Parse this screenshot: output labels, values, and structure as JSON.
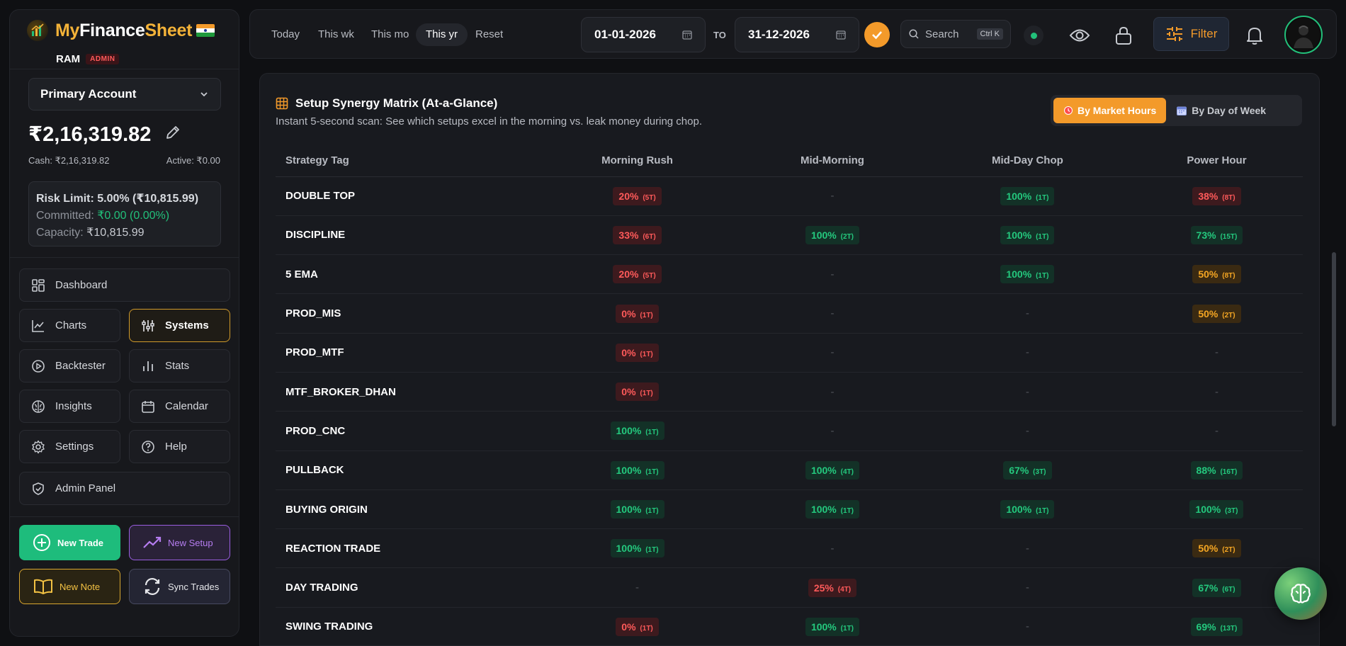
{
  "brand": {
    "name_part1": "My",
    "name_part2": "Finance",
    "name_part3": "Sheet"
  },
  "user": {
    "name": "RAM",
    "role_badge": "ADMIN"
  },
  "account": {
    "selected": "Primary Account",
    "balance": "₹2,16,319.82",
    "cash": "Cash: ₹2,16,319.82",
    "active": "Active: ₹0.00",
    "risk_limit": "Risk Limit: 5.00% (₹10,815.99)",
    "committed_label": "Committed: ",
    "committed_value": "₹0.00 (0.00%)",
    "capacity_label": "Capacity: ",
    "capacity_value": "₹10,815.99"
  },
  "nav": {
    "dashboard": "Dashboard",
    "charts": "Charts",
    "systems": "Systems",
    "backtester": "Backtester",
    "stats": "Stats",
    "insights": "Insights",
    "calendar": "Calendar",
    "settings": "Settings",
    "help": "Help",
    "admin_panel": "Admin Panel"
  },
  "actions": {
    "new_trade": "New Trade",
    "new_setup": "New Setup",
    "new_note": "New Note",
    "sync_trades": "Sync Trades"
  },
  "topbar": {
    "quick_filters": [
      "Today",
      "This wk",
      "This mo",
      "This yr",
      "Reset"
    ],
    "selected_filter": "This yr",
    "date_from": "01-01-2026",
    "to_label": "TO",
    "date_to": "31-12-2026",
    "search_placeholder": "Search",
    "search_shortcut": "Ctrl K",
    "filter_label": "Filter"
  },
  "matrix": {
    "title": "Setup Synergy Matrix (At-a-Glance)",
    "subtitle": "Instant 5-second scan: See which setups excel in the morning vs. leak money during chop.",
    "toggle_market_hours": "By Market Hours",
    "toggle_day_of_week": "By Day of Week",
    "columns": [
      "Strategy Tag",
      "Morning Rush",
      "Mid-Morning",
      "Mid-Day Chop",
      "Power Hour"
    ],
    "rows": [
      {
        "tag": "DOUBLE TOP",
        "cells": [
          {
            "pct": "20%",
            "trades": "(5T)",
            "tone": "red"
          },
          {
            "pct": "-",
            "trades": "",
            "tone": "none"
          },
          {
            "pct": "100%",
            "trades": "(1T)",
            "tone": "green"
          },
          {
            "pct": "38%",
            "trades": "(8T)",
            "tone": "red"
          }
        ]
      },
      {
        "tag": "DISCIPLINE",
        "cells": [
          {
            "pct": "33%",
            "trades": "(6T)",
            "tone": "red"
          },
          {
            "pct": "100%",
            "trades": "(2T)",
            "tone": "green"
          },
          {
            "pct": "100%",
            "trades": "(1T)",
            "tone": "green"
          },
          {
            "pct": "73%",
            "trades": "(15T)",
            "tone": "green"
          }
        ]
      },
      {
        "tag": "5 EMA",
        "cells": [
          {
            "pct": "20%",
            "trades": "(5T)",
            "tone": "red"
          },
          {
            "pct": "-",
            "trades": "",
            "tone": "none"
          },
          {
            "pct": "100%",
            "trades": "(1T)",
            "tone": "green"
          },
          {
            "pct": "50%",
            "trades": "(8T)",
            "tone": "orange"
          }
        ]
      },
      {
        "tag": "PROD_MIS",
        "cells": [
          {
            "pct": "0%",
            "trades": "(1T)",
            "tone": "red"
          },
          {
            "pct": "-",
            "trades": "",
            "tone": "none"
          },
          {
            "pct": "-",
            "trades": "",
            "tone": "none"
          },
          {
            "pct": "50%",
            "trades": "(2T)",
            "tone": "orange"
          }
        ]
      },
      {
        "tag": "PROD_MTF",
        "cells": [
          {
            "pct": "0%",
            "trades": "(1T)",
            "tone": "red"
          },
          {
            "pct": "-",
            "trades": "",
            "tone": "none"
          },
          {
            "pct": "-",
            "trades": "",
            "tone": "none"
          },
          {
            "pct": "-",
            "trades": "",
            "tone": "none"
          }
        ]
      },
      {
        "tag": "MTF_BROKER_DHAN",
        "cells": [
          {
            "pct": "0%",
            "trades": "(1T)",
            "tone": "red"
          },
          {
            "pct": "-",
            "trades": "",
            "tone": "none"
          },
          {
            "pct": "-",
            "trades": "",
            "tone": "none"
          },
          {
            "pct": "-",
            "trades": "",
            "tone": "none"
          }
        ]
      },
      {
        "tag": "PROD_CNC",
        "cells": [
          {
            "pct": "100%",
            "trades": "(1T)",
            "tone": "green"
          },
          {
            "pct": "-",
            "trades": "",
            "tone": "none"
          },
          {
            "pct": "-",
            "trades": "",
            "tone": "none"
          },
          {
            "pct": "-",
            "trades": "",
            "tone": "none"
          }
        ]
      },
      {
        "tag": "PULLBACK",
        "cells": [
          {
            "pct": "100%",
            "trades": "(1T)",
            "tone": "green"
          },
          {
            "pct": "100%",
            "trades": "(4T)",
            "tone": "green"
          },
          {
            "pct": "67%",
            "trades": "(3T)",
            "tone": "green"
          },
          {
            "pct": "88%",
            "trades": "(16T)",
            "tone": "green"
          }
        ]
      },
      {
        "tag": "BUYING ORIGIN",
        "cells": [
          {
            "pct": "100%",
            "trades": "(1T)",
            "tone": "green"
          },
          {
            "pct": "100%",
            "trades": "(1T)",
            "tone": "green"
          },
          {
            "pct": "100%",
            "trades": "(1T)",
            "tone": "green"
          },
          {
            "pct": "100%",
            "trades": "(3T)",
            "tone": "green"
          }
        ]
      },
      {
        "tag": "REACTION TRADE",
        "cells": [
          {
            "pct": "100%",
            "trades": "(1T)",
            "tone": "green"
          },
          {
            "pct": "-",
            "trades": "",
            "tone": "none"
          },
          {
            "pct": "-",
            "trades": "",
            "tone": "none"
          },
          {
            "pct": "50%",
            "trades": "(2T)",
            "tone": "orange"
          }
        ]
      },
      {
        "tag": "DAY TRADING",
        "cells": [
          {
            "pct": "-",
            "trades": "",
            "tone": "none"
          },
          {
            "pct": "25%",
            "trades": "(4T)",
            "tone": "red"
          },
          {
            "pct": "-",
            "trades": "",
            "tone": "none"
          },
          {
            "pct": "67%",
            "trades": "(6T)",
            "tone": "green"
          }
        ]
      },
      {
        "tag": "SWING TRADING",
        "cells": [
          {
            "pct": "0%",
            "trades": "(1T)",
            "tone": "red"
          },
          {
            "pct": "100%",
            "trades": "(1T)",
            "tone": "green"
          },
          {
            "pct": "-",
            "trades": "",
            "tone": "none"
          },
          {
            "pct": "69%",
            "trades": "(13T)",
            "tone": "green"
          }
        ]
      }
    ]
  },
  "colors": {
    "accent_orange": "#f39a2a",
    "brand_gold": "#f3b238",
    "positive": "#24c97e",
    "negative": "#ff5a5a",
    "warning": "#f5a623"
  }
}
